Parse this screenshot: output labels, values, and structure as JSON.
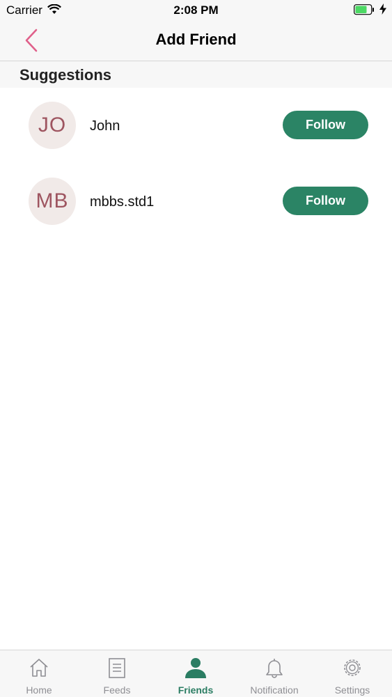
{
  "status_bar": {
    "carrier": "Carrier",
    "time": "2:08 PM"
  },
  "nav": {
    "title": "Add Friend",
    "back_icon": "chevron-left-icon"
  },
  "section": {
    "title": "Suggestions"
  },
  "suggestions": [
    {
      "initials": "JO",
      "name": "John",
      "button_label": "Follow"
    },
    {
      "initials": "MB",
      "name": "mbbs.std1",
      "button_label": "Follow"
    }
  ],
  "tabs": [
    {
      "label": "Home",
      "icon": "home-icon"
    },
    {
      "label": "Feeds",
      "icon": "document-icon"
    },
    {
      "label": "Friends",
      "icon": "person-icon",
      "active": true
    },
    {
      "label": "Notification",
      "icon": "bell-icon"
    },
    {
      "label": "Settings",
      "icon": "gear-icon"
    }
  ],
  "colors": {
    "accent": "#2b8465",
    "back_chevron": "#e0608a",
    "avatar_bg": "#f1eae8",
    "avatar_text": "#9e5560",
    "battery": "#4cd964"
  }
}
